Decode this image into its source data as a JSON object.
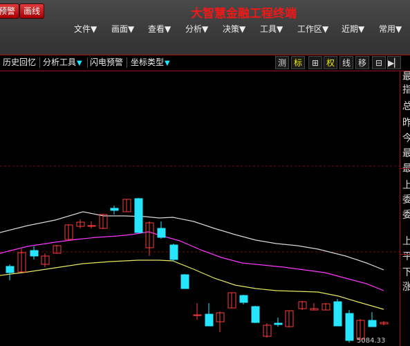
{
  "app": {
    "title": "大智慧金融工程终端",
    "buttons": {
      "warn": "预警",
      "draw": "画线"
    }
  },
  "menu": [
    "文件▼",
    "画面▼",
    "查看▼",
    "分析▼",
    "决策▼",
    "工具▼",
    "工作区▼",
    "近期▼",
    "常用▼"
  ],
  "toolbar": {
    "history": "历史回忆",
    "analysis_tools": "分析工具",
    "flash_alert": "闪电预警",
    "coord_type": "坐标类型",
    "tools": [
      "测",
      "标",
      "⊞",
      "权",
      "线",
      "移",
      "⊟",
      "▶▏"
    ]
  },
  "side_panel": {
    "labels": [
      "最",
      "指",
      "总",
      "昨",
      "今",
      "最",
      "最",
      "上",
      "委",
      "委",
      "上",
      "平",
      "下",
      "涨"
    ]
  },
  "chart": {
    "price_label": "5084.33",
    "colors": {
      "up": "#ff3c3c",
      "down": "#26e6ff",
      "band_upper": "#d8d8d8",
      "band_middle": "#ff38ff",
      "band_lower": "#e8e860",
      "grid": "#7a0c0c"
    }
  }
}
